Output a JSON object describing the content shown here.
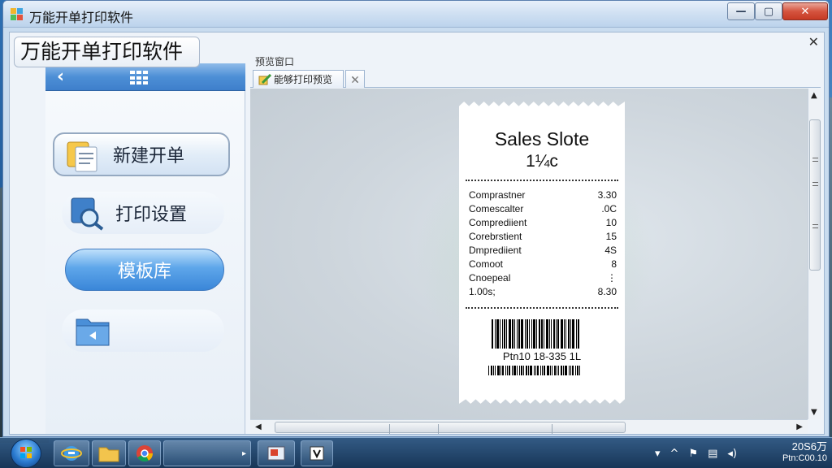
{
  "window": {
    "title": "万能开单打印软件",
    "minimize": "—",
    "maximize": "▢",
    "close": "✕"
  },
  "client": {
    "close": "✕",
    "banner": "万能开单打印软件"
  },
  "nav": {
    "back": "‹",
    "items": [
      {
        "label": "新建开单",
        "icon": "documents-icon"
      },
      {
        "label": "打印设置",
        "icon": "magnifier-icon"
      },
      {
        "label": "模板库",
        "icon": ""
      },
      {
        "label": "",
        "icon": "folder-back-icon"
      }
    ]
  },
  "content": {
    "caption": "预览窗口",
    "tabs": [
      {
        "label": "能够打印预览"
      },
      {
        "label": ""
      }
    ]
  },
  "receipt": {
    "title": "Sales Slote",
    "subtitle": "1¼c",
    "rows": [
      {
        "name": "Comprastner",
        "value": "3.30"
      },
      {
        "name": "Comescalter",
        "value": ".0C"
      },
      {
        "name": "Comprediient",
        "value": "10"
      },
      {
        "name": "Corebrstient",
        "value": "15"
      },
      {
        "name": "Dmprediient",
        "value": "4S"
      },
      {
        "name": "Comoot",
        "value": "8"
      },
      {
        "name": "Cnoepeal",
        "value": "⋮"
      },
      {
        "name": "1.00s;",
        "value": "8.30"
      }
    ],
    "code": "Ptn10 18-335 1L"
  },
  "taskbar": {
    "more": "▸",
    "tray": {
      "caret": "▾",
      "up": "^",
      "flag": "⚑",
      "network": "▤",
      "volume": "◂)"
    },
    "clock_time": "20S6万",
    "clock_date": "Ptn:C00.10"
  },
  "colors": {
    "accent": "#3a86d8",
    "title_gradient_top": "#e7f0fa",
    "close_red": "#c63a24"
  }
}
